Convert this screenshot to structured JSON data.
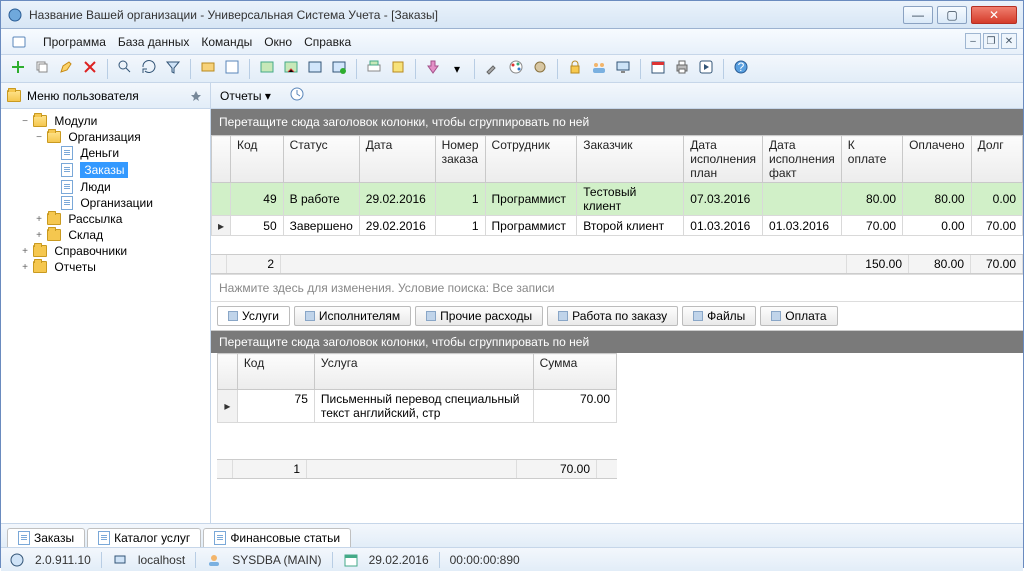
{
  "window": {
    "title": "Название Вашей организации - Универсальная Система Учета - [Заказы]"
  },
  "menu": {
    "program": "Программа",
    "database": "База данных",
    "commands": "Команды",
    "window": "Окно",
    "help": "Справка"
  },
  "user_menu_label": "Меню пользователя",
  "reports_dropdown": "Отчеты ▾",
  "tree": {
    "modules": "Модули",
    "organization": "Организация",
    "money": "Деньги",
    "orders": "Заказы",
    "people": "Люди",
    "orgs": "Организации",
    "mailing": "Рассылка",
    "warehouse": "Склад",
    "directories": "Справочники",
    "reports": "Отчеты"
  },
  "grid1": {
    "group_hint": "Перетащите сюда заголовок колонки, чтобы сгруппировать по ней",
    "cols": {
      "code": "Код",
      "status": "Статус",
      "date": "Дата",
      "order_no": "Номер заказа",
      "employee": "Сотрудник",
      "customer": "Заказчик",
      "plan_date": "Дата исполнения план",
      "fact_date": "Дата исполнения факт",
      "to_pay": "К оплате",
      "paid": "Оплачено",
      "debt": "Долг"
    },
    "rows": [
      {
        "code": "49",
        "status": "В работе",
        "date": "29.02.2016",
        "order_no": "1",
        "employee": "Программист",
        "customer": "Тестовый клиент",
        "plan_date": "07.03.2016",
        "fact_date": "",
        "to_pay": "80.00",
        "paid": "80.00",
        "debt": "0.00",
        "hl": true
      },
      {
        "code": "50",
        "status": "Завершено",
        "date": "29.02.2016",
        "order_no": "1",
        "employee": "Программист",
        "customer": "Второй клиент",
        "plan_date": "01.03.2016",
        "fact_date": "01.03.2016",
        "to_pay": "70.00",
        "paid": "0.00",
        "debt": "70.00",
        "hl": false
      }
    ],
    "sum": {
      "count": "2",
      "to_pay": "150.00",
      "paid": "80.00",
      "debt": "70.00"
    }
  },
  "search_hint": "Нажмите здесь для изменения. Условие поиска: Все записи",
  "detail_tabs": {
    "services": "Услуги",
    "performers": "Исполнителям",
    "other_expenses": "Прочие расходы",
    "work": "Работа по заказу",
    "files": "Файлы",
    "payment": "Оплата"
  },
  "grid2": {
    "group_hint": "Перетащите сюда заголовок колонки, чтобы сгруппировать по ней",
    "cols": {
      "code": "Код",
      "service": "Услуга",
      "sum": "Сумма"
    },
    "rows": [
      {
        "code": "75",
        "service": "Письменный перевод специальный текст английский, стр",
        "sum": "70.00"
      }
    ],
    "sum": {
      "count": "1",
      "sum": "70.00"
    }
  },
  "bottom_tabs": {
    "orders": "Заказы",
    "catalog": "Каталог услуг",
    "fin": "Финансовые статьи"
  },
  "status": {
    "version": "2.0.911.10",
    "host": "localhost",
    "user": "SYSDBA (MAIN)",
    "date": "29.02.2016",
    "time": "00:00:00:890"
  }
}
